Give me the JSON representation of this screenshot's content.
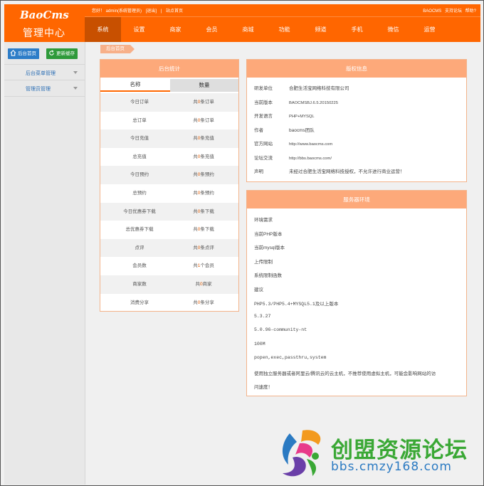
{
  "header": {
    "logo": "BaoCms",
    "brand": "管理中心",
    "welcome": "您好！ admin(系统管理员)",
    "logout": "[退出]",
    "home_link": "站点首页",
    "right_links": [
      "BAOCMS",
      "支持论坛",
      "帮助?"
    ],
    "nav": [
      "系统",
      "设置",
      "商家",
      "会员",
      "商城",
      "功能",
      "频道",
      "手机",
      "微信",
      "运营"
    ],
    "active_nav": "系统"
  },
  "sidebar": {
    "home_button": "后台首页",
    "cache_button": "更新缓存",
    "menus": [
      "后台菜单管理",
      "管理员管理"
    ]
  },
  "breadcrumb": "后台首页",
  "stats": {
    "title": "后台统计",
    "col_name": "名称",
    "col_count": "数量",
    "rows": [
      {
        "name": "今日订单",
        "pre": "共",
        "n": "0",
        "post": "条订单"
      },
      {
        "name": "总订单",
        "pre": "共",
        "n": "0",
        "post": "条订单"
      },
      {
        "name": "今日充值",
        "pre": "共",
        "n": "0",
        "post": "条充值"
      },
      {
        "name": "总充值",
        "pre": "共",
        "n": "0",
        "post": "条充值"
      },
      {
        "name": "今日预约",
        "pre": "共",
        "n": "0",
        "post": "条预约"
      },
      {
        "name": "总预约",
        "pre": "共",
        "n": "0",
        "post": "条预约"
      },
      {
        "name": "今日优惠券下载",
        "pre": "共",
        "n": "0",
        "post": "条下载"
      },
      {
        "name": "总优惠券下载",
        "pre": "共",
        "n": "0",
        "post": "条下载"
      },
      {
        "name": "点评",
        "pre": "共",
        "n": "0",
        "post": "条点评"
      },
      {
        "name": "会员数",
        "pre": "共",
        "n": "1",
        "post": "个会员"
      },
      {
        "name": "商家数",
        "pre": "共",
        "n": "0",
        "post": "商家"
      },
      {
        "name": "消费分享",
        "pre": "共",
        "n": "0",
        "post": "条分享"
      }
    ]
  },
  "copyright": {
    "title": "版权信息",
    "rows": [
      {
        "k": "研发单位",
        "v": "合肥生活宝网络科技有限公司"
      },
      {
        "k": "当前版本",
        "v": "BAOCMSBJ.6.5.20150225"
      },
      {
        "k": "开发语言",
        "v": "PHP+MYSQL"
      },
      {
        "k": "作者",
        "v": "baocms团队"
      },
      {
        "k": "官方网站",
        "v": "http://www.baocms.com"
      },
      {
        "k": "论坛交流",
        "v": "http://bbs.baocms.com/"
      },
      {
        "k": "声明",
        "v": "未经过合肥生活宝网络科技授权，不允许进行商业运营！"
      }
    ]
  },
  "server": {
    "title": "服务器环境",
    "lines": [
      "环境需求",
      "当前PHP版本",
      "当前mysql版本",
      "上传限制",
      "系统限制函数",
      "建议",
      "PHP5.3/PHP5.4+MYSQL5.1及以上版本",
      "5.3.27",
      "5.0.96-community-nt",
      "100M",
      "popen,exec,passthru,system",
      "使用独立服务器或者阿里云/腾讯云的云主机，不推荐使用虚拟主机，可能会影响网站的访",
      "问速度！"
    ]
  },
  "watermark": {
    "line1": "创盟资源论坛",
    "line2": "bbs.cmzy168.com"
  }
}
